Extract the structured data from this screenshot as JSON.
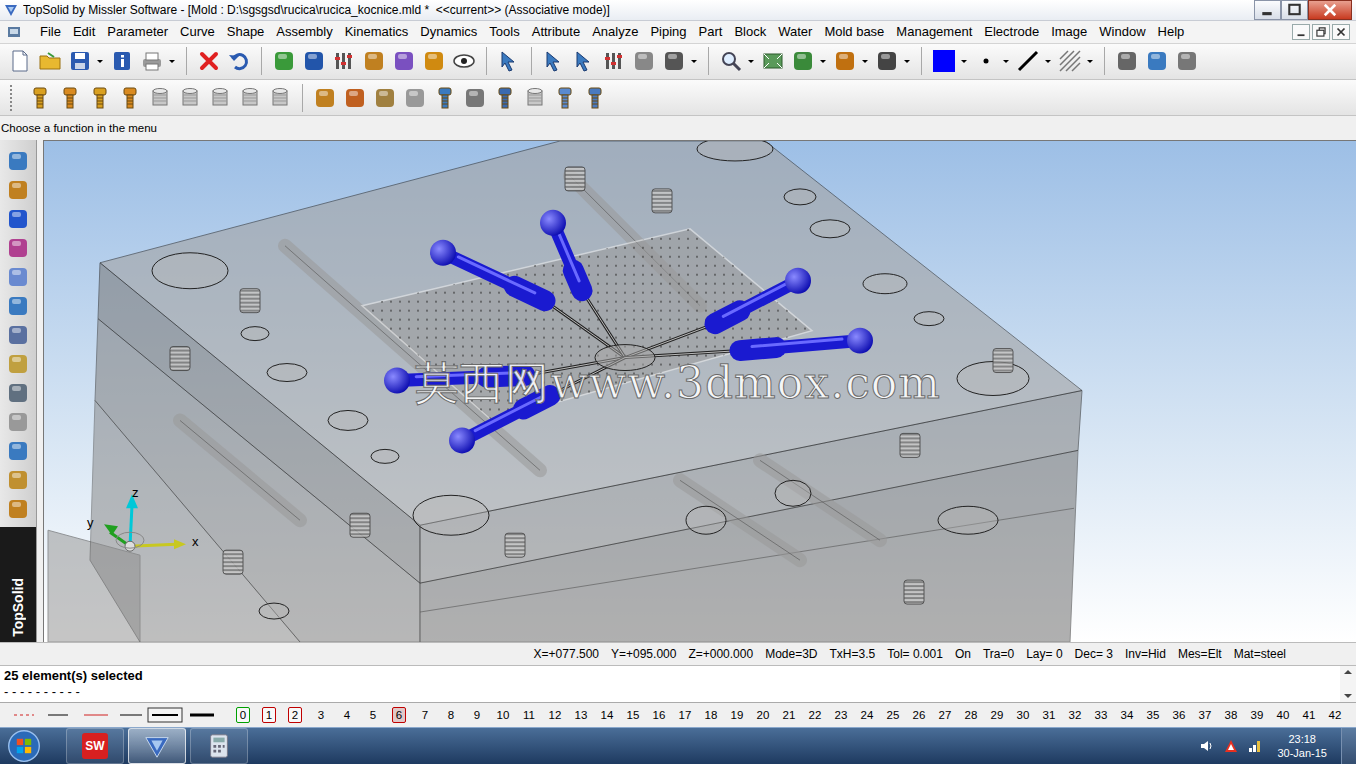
{
  "window": {
    "title": "TopSolid by Missler Software - [Mold : D:\\sgsgsd\\rucica\\rucica_kocnice.mld *  <<current>> (Associative mode)]"
  },
  "menu": [
    "File",
    "Edit",
    "Parameter",
    "Curve",
    "Shape",
    "Assembly",
    "Kinematics",
    "Dynamics",
    "Tools",
    "Attribute",
    "Analyze",
    "Piping",
    "Part",
    "Block",
    "Water",
    "Mold base",
    "Management",
    "Electrode",
    "Image",
    "Window",
    "Help"
  ],
  "toolbar": {
    "drawing_color": "#0000ff"
  },
  "prompt": "Choose a function in the menu",
  "left_toolbar": {
    "brand": "TopSolid"
  },
  "viewport": {
    "watermark": "莫西网www.3dmox.com",
    "axes": [
      "z",
      "y",
      "x"
    ]
  },
  "status_bar": [
    "X=+077.500",
    "Y=+095.000",
    "Z=+000.000",
    "Mode=3D",
    "TxH=3.5",
    "Tol= 0.001",
    "On",
    "Tra=0",
    "Lay= 0",
    "Dec= 3",
    "Inv=Hid",
    "Mes=Elt",
    "Mat=steel"
  ],
  "messages": [
    "25 element(s) selected",
    "- - - - - - - - - -"
  ],
  "layers": [
    {
      "label": "0",
      "boxed": true,
      "color": "#00a000",
      "selected": false
    },
    {
      "label": "1",
      "boxed": true,
      "color": "#c00000",
      "selected": false
    },
    {
      "label": "2",
      "boxed": true,
      "color": "#c00000",
      "selected": false
    },
    {
      "label": "3",
      "boxed": false,
      "selected": false
    },
    {
      "label": "4",
      "boxed": false,
      "selected": false
    },
    {
      "label": "5",
      "boxed": false,
      "selected": false
    },
    {
      "label": "6",
      "boxed": true,
      "color": "#c00000",
      "selected": true
    },
    {
      "label": "7",
      "boxed": false,
      "selected": false
    },
    {
      "label": "8",
      "boxed": false,
      "selected": false
    },
    {
      "label": "9",
      "boxed": false,
      "selected": false
    },
    {
      "label": "10",
      "boxed": false,
      "selected": false
    },
    {
      "label": "11",
      "boxed": false,
      "selected": false
    },
    {
      "label": "12",
      "boxed": false,
      "selected": false
    },
    {
      "label": "13",
      "boxed": false,
      "selected": false
    },
    {
      "label": "14",
      "boxed": false,
      "selected": false
    },
    {
      "label": "15",
      "boxed": false,
      "selected": false
    },
    {
      "label": "16",
      "boxed": false,
      "selected": false
    },
    {
      "label": "17",
      "boxed": false,
      "selected": false
    },
    {
      "label": "18",
      "boxed": false,
      "selected": false
    },
    {
      "label": "19",
      "boxed": false,
      "selected": false
    },
    {
      "label": "20",
      "boxed": false,
      "selected": false
    },
    {
      "label": "21",
      "boxed": false,
      "selected": false
    },
    {
      "label": "22",
      "boxed": false,
      "selected": false
    },
    {
      "label": "23",
      "boxed": false,
      "selected": false
    },
    {
      "label": "24",
      "boxed": false,
      "selected": false
    },
    {
      "label": "25",
      "boxed": false,
      "selected": false
    },
    {
      "label": "26",
      "boxed": false,
      "selected": false
    },
    {
      "label": "27",
      "boxed": false,
      "selected": false
    },
    {
      "label": "28",
      "boxed": false,
      "selected": false
    },
    {
      "label": "29",
      "boxed": false,
      "selected": false
    },
    {
      "label": "30",
      "boxed": false,
      "selected": false
    },
    {
      "label": "31",
      "boxed": false,
      "selected": false
    },
    {
      "label": "32",
      "boxed": false,
      "selected": false
    },
    {
      "label": "33",
      "boxed": false,
      "selected": false
    },
    {
      "label": "34",
      "boxed": false,
      "selected": false
    },
    {
      "label": "35",
      "boxed": false,
      "selected": false
    },
    {
      "label": "36",
      "boxed": false,
      "selected": false
    },
    {
      "label": "37",
      "boxed": false,
      "selected": false
    },
    {
      "label": "38",
      "boxed": false,
      "selected": false
    },
    {
      "label": "39",
      "boxed": false,
      "selected": false
    },
    {
      "label": "40",
      "boxed": false,
      "selected": false
    },
    {
      "label": "41",
      "boxed": false,
      "selected": false
    },
    {
      "label": "42",
      "boxed": false,
      "selected": false
    }
  ],
  "taskbar": {
    "apps": [
      {
        "kind": "solidworks",
        "logo_text": "SW",
        "selected": false
      },
      {
        "kind": "topsolid",
        "selected": true
      },
      {
        "kind": "calculator",
        "selected": false
      }
    ]
  },
  "clock": {
    "time": "23:18",
    "date": "30-Jan-15"
  }
}
